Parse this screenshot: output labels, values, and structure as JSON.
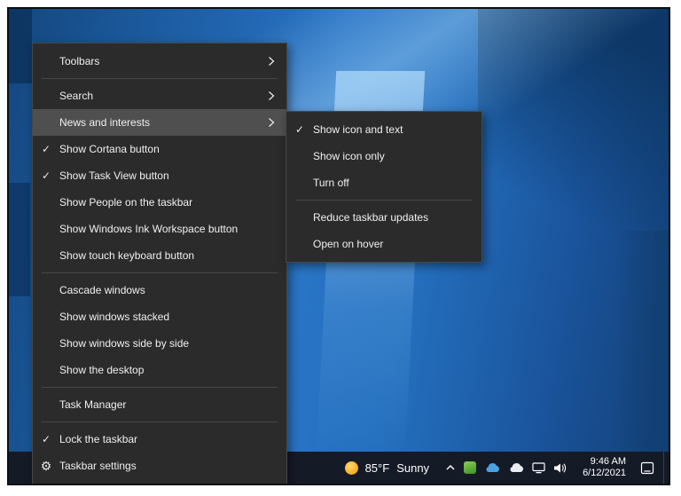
{
  "icons": {
    "gear": "⚙",
    "check": "✓"
  },
  "context_menu": {
    "items": [
      {
        "label": "Toolbars",
        "check": "",
        "has_submenu": true
      },
      {
        "label": "Search",
        "check": "",
        "has_submenu": true
      },
      {
        "label": "News and interests",
        "check": "",
        "has_submenu": true,
        "highlighted": true
      },
      {
        "label": "Show Cortana button",
        "check": "✓"
      },
      {
        "label": "Show Task View button",
        "check": "✓"
      },
      {
        "label": "Show People on the taskbar",
        "check": ""
      },
      {
        "label": "Show Windows Ink Workspace button",
        "check": ""
      },
      {
        "label": "Show touch keyboard button",
        "check": ""
      },
      {
        "label": "Cascade windows",
        "check": ""
      },
      {
        "label": "Show windows stacked",
        "check": ""
      },
      {
        "label": "Show windows side by side",
        "check": ""
      },
      {
        "label": "Show the desktop",
        "check": ""
      },
      {
        "label": "Task Manager",
        "check": ""
      },
      {
        "label": "Lock the taskbar",
        "check": "✓"
      },
      {
        "label": "Taskbar settings",
        "check": "",
        "icon": "gear"
      }
    ]
  },
  "news_submenu": {
    "items": [
      {
        "label": "Show icon and text",
        "check": "✓"
      },
      {
        "label": "Show icon only",
        "check": ""
      },
      {
        "label": "Turn off",
        "check": ""
      },
      {
        "label": "Reduce taskbar updates",
        "check": ""
      },
      {
        "label": "Open on hover",
        "check": ""
      }
    ]
  },
  "taskbar": {
    "weather": {
      "temperature": "85°F",
      "condition": "Sunny"
    },
    "clock": {
      "time": "9:46 AM",
      "date": "6/12/2021"
    }
  },
  "colors": {
    "menu_bg": "#2b2b2b",
    "menu_highlight": "#4f4f4f",
    "menu_border": "#484848",
    "taskbar_bg": "#151a27",
    "desktop_blue": "#2470bf",
    "sun_yellow": "#f5a623"
  }
}
